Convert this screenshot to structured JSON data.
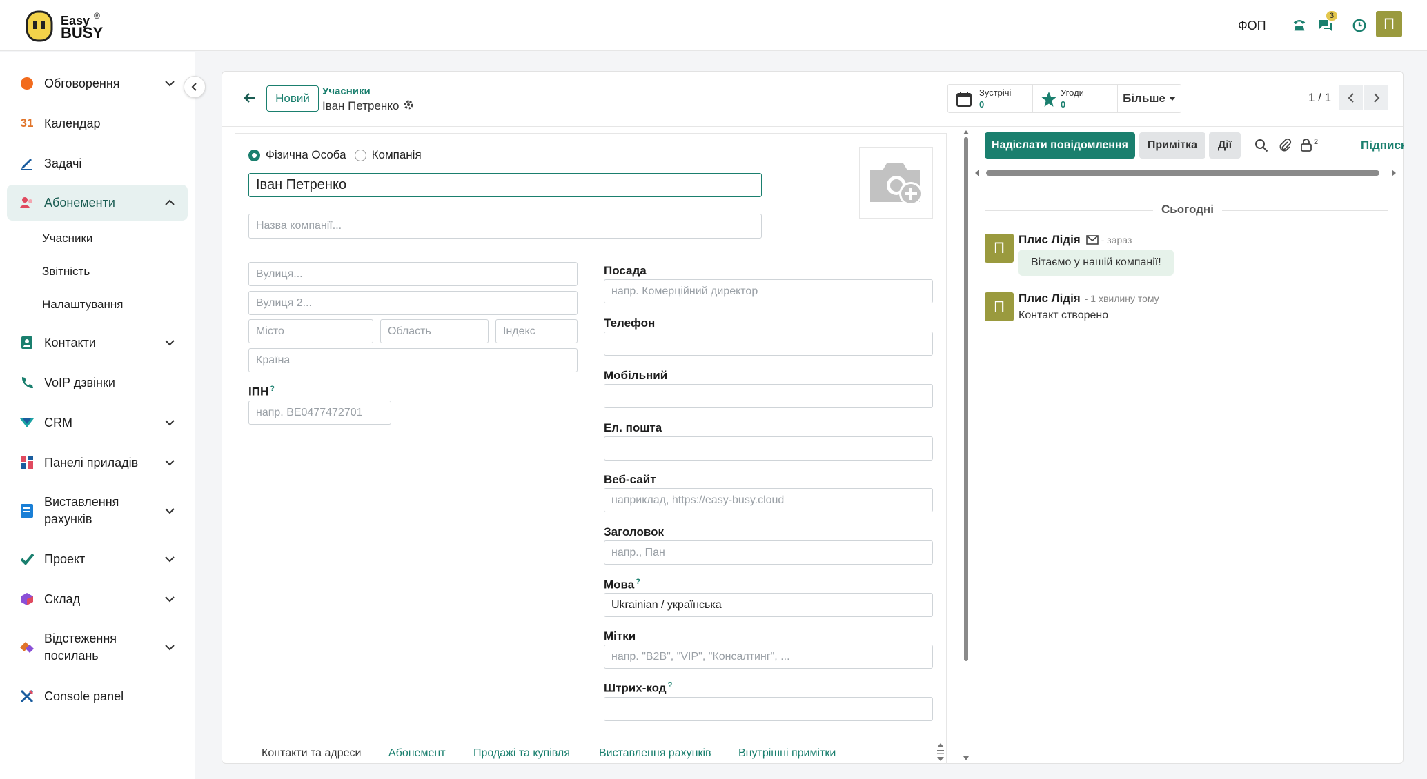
{
  "app": {
    "brand_line1": "Easy",
    "brand_line2": "BUSY",
    "company": "ФОП",
    "chat_badge": "3",
    "avatar": "П"
  },
  "sidebar": {
    "items": [
      {
        "label": "Обговорення",
        "icon": "discuss-icon"
      },
      {
        "label": "Календар",
        "icon": "calendar-icon"
      },
      {
        "label": "Задачі",
        "icon": "pencil-icon"
      },
      {
        "label": "Абонементи",
        "icon": "members-icon"
      },
      {
        "label": "Контакти",
        "icon": "contacts-icon"
      },
      {
        "label": "VoIP дзвінки",
        "icon": "phone-icon"
      },
      {
        "label": "CRM",
        "icon": "crm-icon"
      },
      {
        "label": "Панелі приладів",
        "icon": "dashboard-icon"
      },
      {
        "label": "Виставлення рахунків",
        "icon": "invoice-icon"
      },
      {
        "label": "Проект",
        "icon": "project-icon"
      },
      {
        "label": "Склад",
        "icon": "inventory-icon"
      },
      {
        "label": "Відстеження посилань",
        "icon": "link-tracker-icon"
      },
      {
        "label": "Console panel",
        "icon": "console-icon"
      }
    ],
    "subitems": [
      "Учасники",
      "Звітність",
      "Налаштування"
    ]
  },
  "control": {
    "new_label": "Новий",
    "breadcrumb_parent": "Учасники",
    "breadcrumb_current": "Іван Петренко",
    "stat_meetings_label": "Зустрічі",
    "stat_meetings_value": "0",
    "stat_deals_label": "Угоди",
    "stat_deals_value": "0",
    "more_label": "Більше",
    "pager": "1 / 1"
  },
  "form": {
    "type_person": "Фізична Особа",
    "type_company": "Компанія",
    "name_value": "Іван Петренко",
    "company_placeholder": "Назва компанії...",
    "street_placeholder": "Вулиця...",
    "street2_placeholder": "Вулиця 2...",
    "city_placeholder": "Місто",
    "state_placeholder": "Область",
    "zip_placeholder": "Індекс",
    "country_placeholder": "Країна",
    "vat_label": "ІПН",
    "vat_placeholder": "напр. BE0477472701",
    "job_label": "Посада",
    "job_placeholder": "напр. Комерційний директор",
    "phone_label": "Телефон",
    "mobile_label": "Мобільний",
    "email_label": "Ел. пошта",
    "website_label": "Веб-сайт",
    "website_placeholder": "наприклад, https://easy-busy.cloud",
    "title_label": "Заголовок",
    "title_placeholder": "напр., Пан",
    "lang_label": "Мова",
    "lang_value": "Ukrainian / українська",
    "tags_label": "Мітки",
    "tags_placeholder": "напр. \"B2B\", \"VIP\", \"Консалтинг\", ...",
    "barcode_label": "Штрих-код",
    "q": "?"
  },
  "tabs": [
    "Контакти та адреси",
    "Абонемент",
    "Продажі та купівля",
    "Виставлення рахунків",
    "Внутрішні примітки"
  ],
  "chatter": {
    "send_label": "Надіслати повідомлення",
    "note_label": "Примітка",
    "activity_label": "Дії",
    "followers_count": "2",
    "follow_label": "Підписк",
    "today": "Сьогодні",
    "messages": [
      {
        "author": "Плис Лідія",
        "time": "- зараз",
        "body": "Вітаємо у нашій компанії!",
        "avatar": "П"
      },
      {
        "author": "Плис Лідія",
        "time": "- 1 хвилину тому",
        "body": "Контакт створено",
        "avatar": "П"
      }
    ]
  },
  "colors": {
    "accent": "#1a7f6e",
    "active_bg": "#e7f1f0",
    "avatar_bg": "#9a9a3e"
  }
}
